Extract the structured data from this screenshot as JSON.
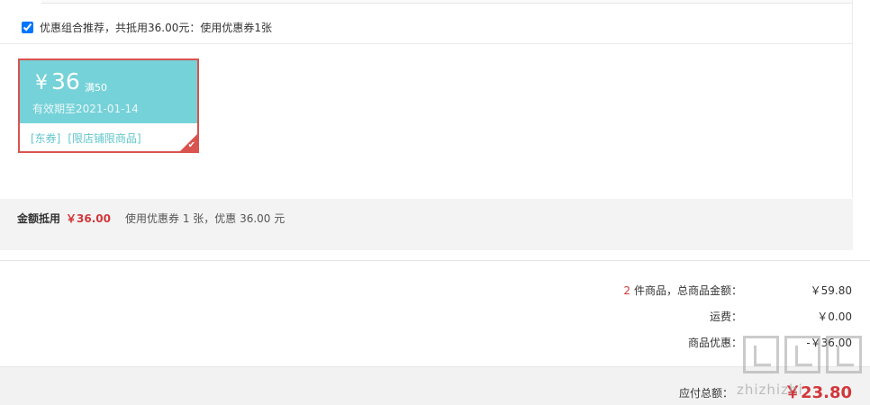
{
  "combo": {
    "checked": true,
    "text": "优惠组合推荐，共抵用36.00元：使用优惠券1张"
  },
  "coupon": {
    "currency": "¥",
    "amount": "36",
    "threshold": "满50",
    "validity": "有效期至2021-01-14",
    "tags": [
      "[东券]",
      "[限店铺限商品]"
    ],
    "selected": true,
    "colors": {
      "top": "#75d2d8",
      "border": "#d9534f"
    }
  },
  "summary": {
    "label": "金额抵用",
    "amount": "￥36.00",
    "desc": "使用优惠券 1 张，优惠 36.00 元"
  },
  "totals": {
    "goods": {
      "count": "2",
      "label": "件商品，总商品金额：",
      "value": "￥59.80"
    },
    "shipping": {
      "label": "运费：",
      "value": "￥0.00"
    },
    "discount": {
      "label": "商品优惠：",
      "value": "-￥36.00"
    }
  },
  "pay": {
    "label": "应付总额：",
    "value": "￥23.80"
  },
  "watermark": {
    "text": "zhizhizhi",
    "icon": "watermark-logo-icon"
  },
  "colors": {
    "accent_red": "#d2373a",
    "coupon_teal": "#75d2d8"
  }
}
